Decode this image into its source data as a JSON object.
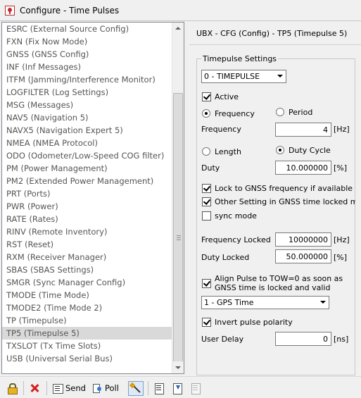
{
  "window": {
    "title": "Configure - Time Pulses",
    "icon": "app-icon"
  },
  "message_list": {
    "selected_index": 24,
    "items": [
      "ESRC (External Source Config)",
      "FXN (Fix Now Mode)",
      "GNSS (GNSS Config)",
      "INF (Inf Messages)",
      "ITFM (Jamming/Interference Monitor)",
      "LOGFILTER (Log Settings)",
      "MSG (Messages)",
      "NAV5 (Navigation 5)",
      "NAVX5 (Navigation Expert 5)",
      "NMEA (NMEA Protocol)",
      "ODO (Odometer/Low-Speed COG filter)",
      "PM (Power Management)",
      "PM2 (Extended Power Management)",
      "PRT (Ports)",
      "PWR (Power)",
      "RATE (Rates)",
      "RINV (Remote Inventory)",
      "RST (Reset)",
      "RXM (Receiver Manager)",
      "SBAS (SBAS Settings)",
      "SMGR (Sync Manager Config)",
      "TMODE (Time Mode)",
      "TMODE2 (Time Mode 2)",
      "TP (Timepulse)",
      "TP5 (Timepulse 5)",
      "TXSLOT (Tx Time Slots)",
      "USB (Universal Serial Bus)"
    ]
  },
  "panel": {
    "message_title": "UBX - CFG (Config) - TP5 (Timepulse 5)",
    "group_title": "Timepulse Settings",
    "timepulse_select": "0 - TIMEPULSE",
    "active": {
      "label": "Active",
      "checked": true
    },
    "frequency_radio": {
      "label": "Frequency",
      "selected": true
    },
    "period_radio": {
      "label": "Period",
      "selected": false
    },
    "frequency": {
      "label": "Frequency",
      "value": "4",
      "unit": "[Hz]"
    },
    "length_radio": {
      "label": "Length",
      "selected": false
    },
    "duty_cycle_radio": {
      "label": "Duty Cycle",
      "selected": true
    },
    "duty": {
      "label": "Duty",
      "value": "10.000000",
      "unit": "[%]"
    },
    "lock_gnss": {
      "label": "Lock to GNSS frequency if available",
      "checked": true
    },
    "other_setting": {
      "label": "Other Setting in GNSS time locked mode",
      "checked": true
    },
    "sync_mode": {
      "label": "sync mode",
      "checked": false
    },
    "frequency_locked": {
      "label": "Frequency Locked",
      "value": "10000000",
      "unit": "[Hz]"
    },
    "duty_locked": {
      "label": "Duty Locked",
      "value": "50.000000",
      "unit": "[%]"
    },
    "align_pulse": {
      "label_line1": "Align Pulse to TOW=0 as soon as",
      "label_line2": "GNSS time is locked and valid",
      "checked": true
    },
    "time_source_select": "1 - GPS Time",
    "invert_polarity": {
      "label": "Invert pulse polarity",
      "checked": true
    },
    "user_delay": {
      "label": "User Delay",
      "value": "0",
      "unit": "[ns]"
    }
  },
  "toolbar": {
    "send_label": "Send",
    "poll_label": "Poll",
    "icons": [
      "lock-icon",
      "cancel-icon",
      "send-icon",
      "poll-icon",
      "magic-wand-icon",
      "document-icon",
      "load-icon",
      "save-icon"
    ]
  }
}
